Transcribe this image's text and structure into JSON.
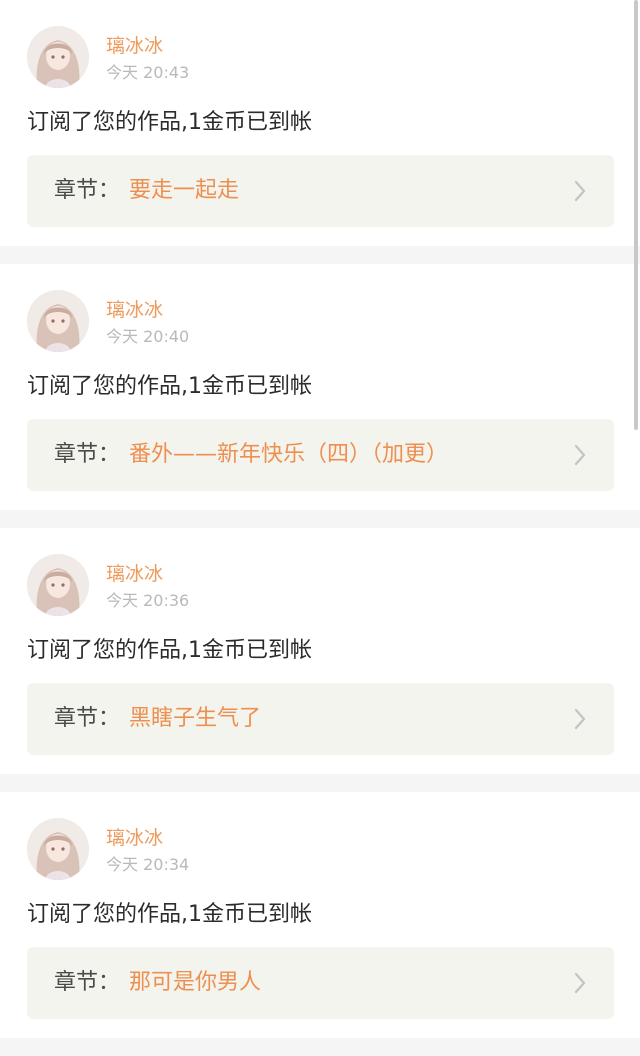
{
  "notifications": [
    {
      "user": "璃冰冰",
      "time": "今天 20:43",
      "message": "订阅了您的作品,1金币已到帐",
      "chapter_label": "章节：",
      "chapter_title": "要走一起走"
    },
    {
      "user": "璃冰冰",
      "time": "今天 20:40",
      "message": "订阅了您的作品,1金币已到帐",
      "chapter_label": "章节：",
      "chapter_title": "番外——新年快乐（四）（加更）"
    },
    {
      "user": "璃冰冰",
      "time": "今天 20:36",
      "message": "订阅了您的作品,1金币已到帐",
      "chapter_label": "章节：",
      "chapter_title": "黑瞎子生气了"
    },
    {
      "user": "璃冰冰",
      "time": "今天 20:34",
      "message": "订阅了您的作品,1金币已到帐",
      "chapter_label": "章节：",
      "chapter_title": "那可是你男人"
    }
  ],
  "colors": {
    "accent": "#ee8f4f",
    "username": "#ee9a5d",
    "timestamp": "#b9b9b9",
    "chapter_bg": "#f4f4ef",
    "page_bg": "#f5f5f5"
  },
  "icons": {
    "avatar": "user-avatar-icon",
    "chevron": "chevron-right-icon"
  }
}
